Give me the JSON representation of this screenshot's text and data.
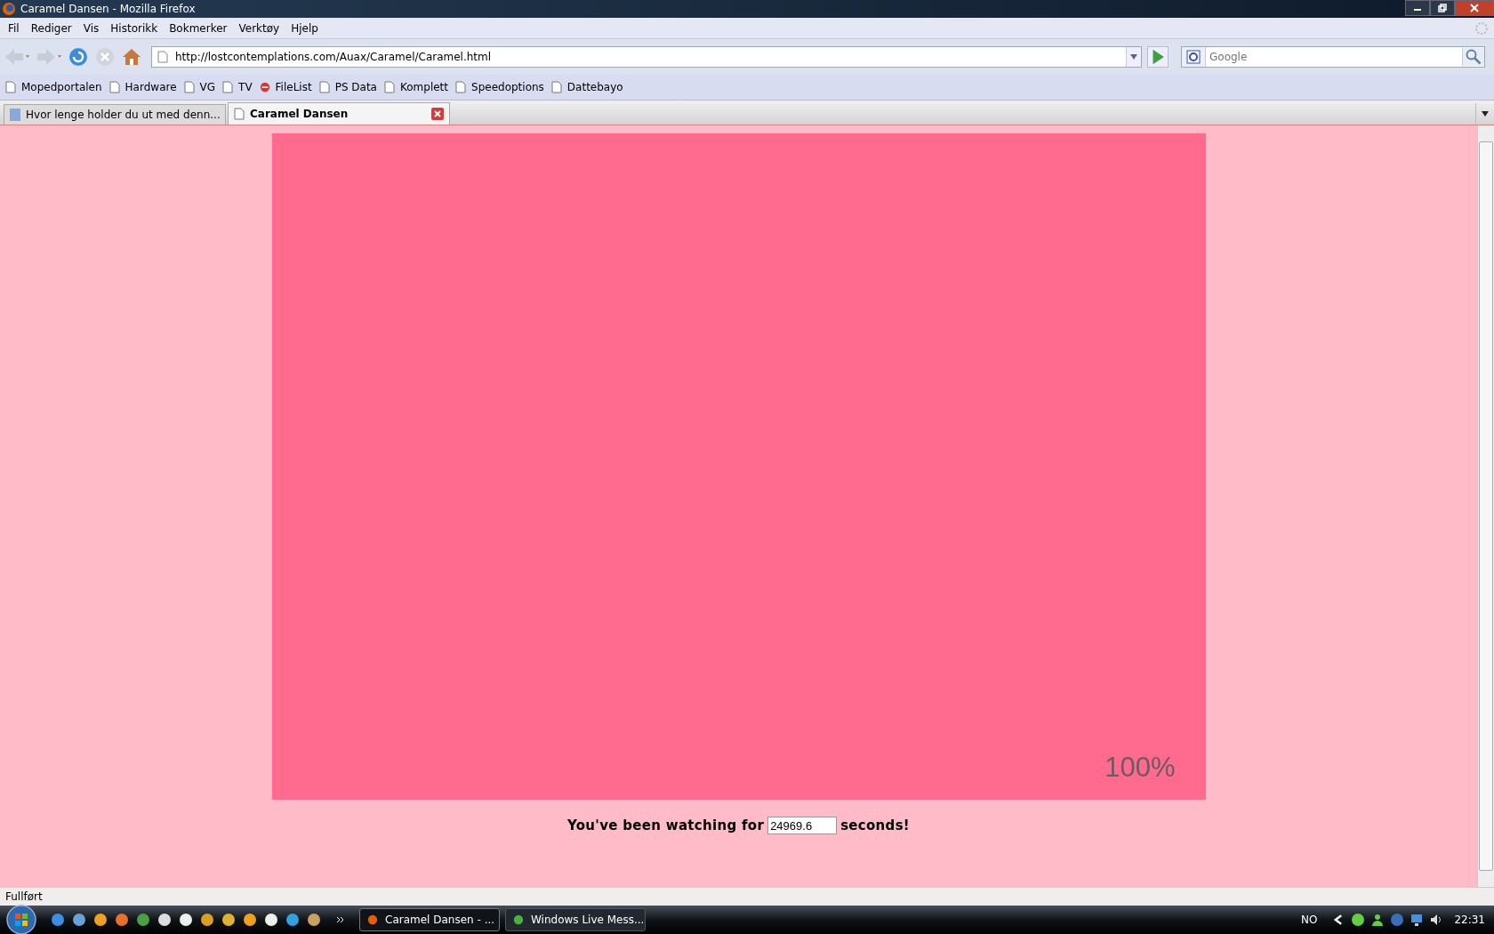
{
  "window": {
    "title": "Caramel Dansen - Mozilla Firefox"
  },
  "menu": [
    "Fil",
    "Rediger",
    "Vis",
    "Historikk",
    "Bokmerker",
    "Verktøy",
    "Hjelp"
  ],
  "navigation": {
    "url": "http://lostcontemplations.com/Auax/Caramel/Caramel.html",
    "search_placeholder": "Google"
  },
  "bookmarks": [
    {
      "label": "Mopedportalen",
      "kind": "page"
    },
    {
      "label": "Hardware",
      "kind": "page"
    },
    {
      "label": "VG",
      "kind": "page"
    },
    {
      "label": "TV",
      "kind": "page"
    },
    {
      "label": "FileList",
      "kind": "site"
    },
    {
      "label": "PS Data",
      "kind": "page"
    },
    {
      "label": "Komplett",
      "kind": "page"
    },
    {
      "label": "Speedoptions",
      "kind": "page"
    },
    {
      "label": "Dattebayo",
      "kind": "page"
    }
  ],
  "tabs": [
    {
      "label": "Hvor lenge holder du ut med denn...",
      "selected": false
    },
    {
      "label": "Caramel Dansen",
      "selected": true
    }
  ],
  "page": {
    "loader_percent": "100%",
    "watch_prefix": "You've been watching for",
    "watch_value": "24969.6",
    "watch_suffix": "seconds!"
  },
  "status_bar": "Fullført",
  "taskbar": {
    "tasks": [
      {
        "label": "Caramel Dansen - ...",
        "selected": true
      },
      {
        "label": "Windows Live Mess...",
        "selected": false
      }
    ],
    "language": "NO",
    "clock": "22:31"
  }
}
